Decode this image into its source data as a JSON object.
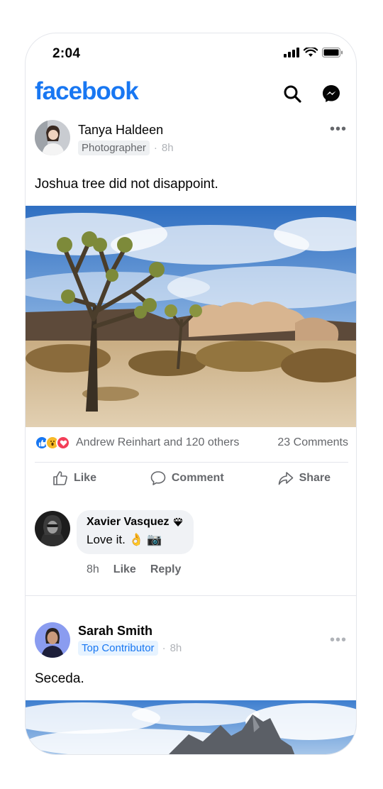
{
  "status": {
    "time": "2:04"
  },
  "header": {
    "logo": "facebook",
    "icons": [
      "search-icon",
      "messenger-icon"
    ]
  },
  "posts": [
    {
      "author": "Tanya Haldeen",
      "badge": "Photographer",
      "time": "8h",
      "more": "•••",
      "caption": "Joshua tree did not disappoint.",
      "reactions_text": "Andrew Reinhart and 120 others",
      "comments_count": "23 Comments",
      "actions": {
        "like": "Like",
        "comment": "Comment",
        "share": "Share"
      },
      "comment": {
        "author": "Xavier Vasquez",
        "text": "Love it. 👌 📷",
        "time": "8h",
        "like": "Like",
        "reply": "Reply"
      }
    },
    {
      "author": "Sarah Smith",
      "badge": "Top Contributor",
      "time": "8h",
      "more": "•••",
      "caption": "Seceda."
    }
  ],
  "colors": {
    "brand": "#1877f2",
    "text": "#050505",
    "secondary": "#65676b",
    "divider": "#e4e6eb"
  }
}
